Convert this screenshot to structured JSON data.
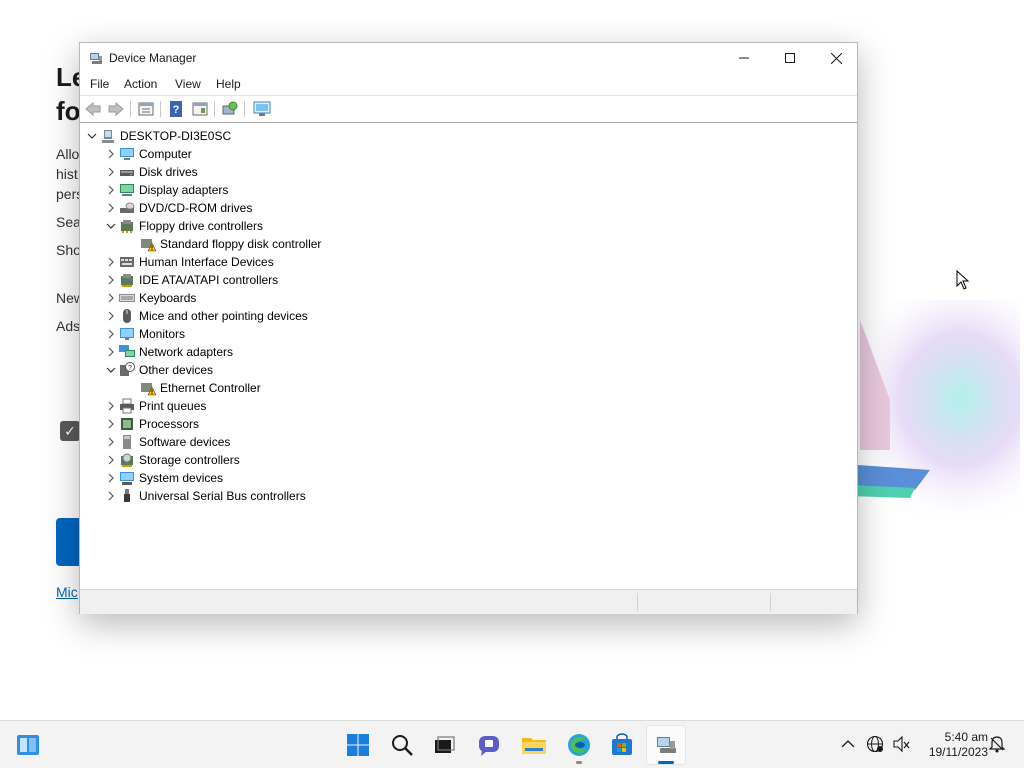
{
  "window": {
    "title": "Device Manager",
    "menu": [
      "File",
      "Action",
      "View",
      "Help"
    ]
  },
  "toolbar": {
    "buttons": [
      "back-arrow-icon",
      "forward-arrow-icon",
      "properties-icon",
      "help-icon",
      "show-hidden-icon",
      "scan-hardware-icon",
      "monitor-icon"
    ]
  },
  "tree": {
    "root": "DESKTOP-DI3E0SC",
    "items": [
      {
        "label": "Computer",
        "icon": "computer-icon",
        "expanded": false
      },
      {
        "label": "Disk drives",
        "icon": "disk-drive-icon",
        "expanded": false
      },
      {
        "label": "Display adapters",
        "icon": "display-adapter-icon",
        "expanded": false
      },
      {
        "label": "DVD/CD-ROM drives",
        "icon": "dvd-drive-icon",
        "expanded": false
      },
      {
        "label": "Floppy drive controllers",
        "icon": "floppy-controller-icon",
        "expanded": true,
        "children": [
          {
            "label": "Standard floppy disk controller",
            "icon": "warning-device-icon"
          }
        ]
      },
      {
        "label": "Human Interface Devices",
        "icon": "hid-icon",
        "expanded": false
      },
      {
        "label": "IDE ATA/ATAPI controllers",
        "icon": "ide-controller-icon",
        "expanded": false
      },
      {
        "label": "Keyboards",
        "icon": "keyboard-icon",
        "expanded": false
      },
      {
        "label": "Mice and other pointing devices",
        "icon": "mouse-icon",
        "expanded": false
      },
      {
        "label": "Monitors",
        "icon": "monitor-icon",
        "expanded": false
      },
      {
        "label": "Network adapters",
        "icon": "network-adapter-icon",
        "expanded": false
      },
      {
        "label": "Other devices",
        "icon": "unknown-device-icon",
        "expanded": true,
        "children": [
          {
            "label": "Ethernet Controller",
            "icon": "warning-device-icon"
          }
        ]
      },
      {
        "label": "Print queues",
        "icon": "printer-icon",
        "expanded": false
      },
      {
        "label": "Processors",
        "icon": "processor-icon",
        "expanded": false
      },
      {
        "label": "Software devices",
        "icon": "software-device-icon",
        "expanded": false
      },
      {
        "label": "Storage controllers",
        "icon": "storage-controller-icon",
        "expanded": false
      },
      {
        "label": "System devices",
        "icon": "system-device-icon",
        "expanded": false
      },
      {
        "label": "Universal Serial Bus controllers",
        "icon": "usb-icon",
        "expanded": false
      }
    ]
  },
  "background_page": {
    "heading": "Le\nfo",
    "lines": [
      "Allo",
      "hist",
      "pers",
      "Sea",
      "Sho",
      "New",
      "Ads"
    ],
    "link": "Mic"
  },
  "taskbar": {
    "apps": [
      "start-icon",
      "search-icon",
      "task-view-icon",
      "chat-icon",
      "file-explorer-icon",
      "edge-icon",
      "store-icon",
      "device-manager-icon"
    ],
    "time": "5:40 am",
    "date": "19/11/2023"
  },
  "colors": {
    "accent": "#0067c0",
    "warning": "#f7c600",
    "taskbar": "#f3f3f3"
  }
}
